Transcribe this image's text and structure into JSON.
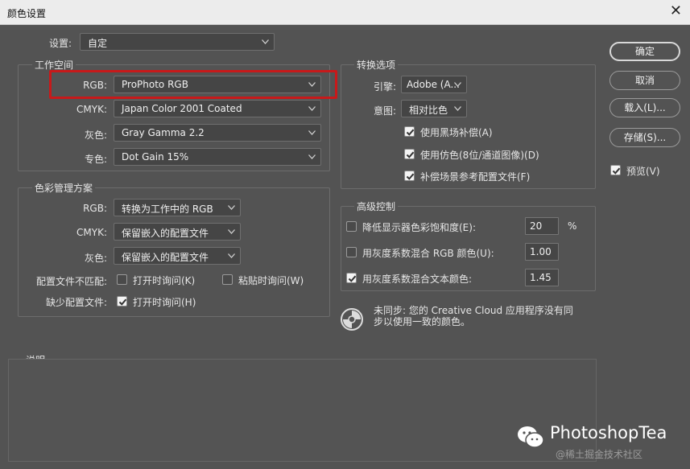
{
  "window": {
    "title": "颜色设置",
    "close_glyph": "✕"
  },
  "settings": {
    "label": "设置:",
    "value": "自定"
  },
  "workspace": {
    "title": "工作空间",
    "rows": [
      {
        "label": "RGB:",
        "value": "ProPhoto RGB"
      },
      {
        "label": "CMYK:",
        "value": "Japan Color 2001 Coated"
      },
      {
        "label": "灰色:",
        "value": "Gray Gamma 2.2"
      },
      {
        "label": "专色:",
        "value": "Dot Gain 15%"
      }
    ]
  },
  "policies": {
    "title": "色彩管理方案",
    "rows": [
      {
        "label": "RGB:",
        "value": "转换为工作中的 RGB"
      },
      {
        "label": "CMYK:",
        "value": "保留嵌入的配置文件"
      },
      {
        "label": "灰色:",
        "value": "保留嵌入的配置文件"
      }
    ],
    "mismatch_label": "配置文件不匹配:",
    "mismatch_open": {
      "label": "打开时询问(K)",
      "checked": false
    },
    "mismatch_paste": {
      "label": "粘贴时询问(W)",
      "checked": false
    },
    "missing_label": "缺少配置文件:",
    "missing_open": {
      "label": "打开时询问(H)",
      "checked": true
    }
  },
  "conversion": {
    "title": "转换选项",
    "engine_label": "引擎:",
    "engine_value": "Adobe (A...",
    "intent_label": "意图:",
    "intent_value": "相对比色",
    "options": [
      {
        "label": "使用黑场补偿(A)",
        "checked": true
      },
      {
        "label": "使用仿色(8位/通道图像)(D)",
        "checked": true
      },
      {
        "label": "补偿场景参考配置文件(F)",
        "checked": true
      }
    ]
  },
  "advanced": {
    "title": "高级控制",
    "rows": [
      {
        "label": "降低显示器色彩饱和度(E):",
        "value": "20",
        "unit": "%",
        "checked": false
      },
      {
        "label": "用灰度系数混合 RGB 颜色(U):",
        "value": "1.00",
        "unit": "",
        "checked": false
      },
      {
        "label": "用灰度系数混合文本颜色:",
        "value": "1.45",
        "unit": "",
        "checked": true
      }
    ]
  },
  "sync": {
    "icon": "sync-status-icon",
    "line1": "未同步: 您的 Creative Cloud 应用程序没有同",
    "line2": "步以使用一致的颜色。"
  },
  "description": {
    "title": "说明"
  },
  "buttons": {
    "ok": "确定",
    "cancel": "取消",
    "load": "载入(L)...",
    "save": "存储(S)...",
    "preview": {
      "label": "预览(V)",
      "checked": true
    }
  },
  "watermark": {
    "brand": "PhotoshopTea",
    "site": "@稀土掘金技术社区"
  },
  "colors": {
    "background": "#535353",
    "highlight": "#c8191a",
    "titlebar": "#ececec"
  }
}
